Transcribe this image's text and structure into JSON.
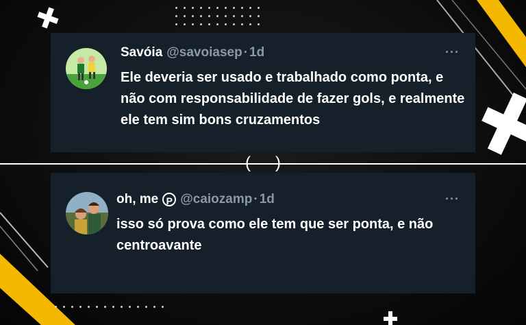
{
  "posts": [
    {
      "name": "Savóia",
      "handle": "@savoiasep",
      "separator": "·",
      "age": "1d",
      "more": "···",
      "text": "Ele deveria ser usado e trabalhado como ponta, e não com responsabilidade de fazer gols, e realmente ele tem sim bons cruzamentos",
      "avatar": "football-players-avatar"
    },
    {
      "name": "oh, me",
      "badge": "P",
      "handle": "@caiozamp",
      "separator": "·",
      "age": "1d",
      "more": "···",
      "text": "isso só prova como ele tem que ser ponta, e não centroavante",
      "avatar": "couple-photo-avatar"
    }
  ],
  "divider": {
    "left_paren": "(",
    "right_paren": ")"
  },
  "colors": {
    "card_bg": "#15202b",
    "accent_yellow": "#f5b800",
    "muted_text": "#8b98a5"
  }
}
